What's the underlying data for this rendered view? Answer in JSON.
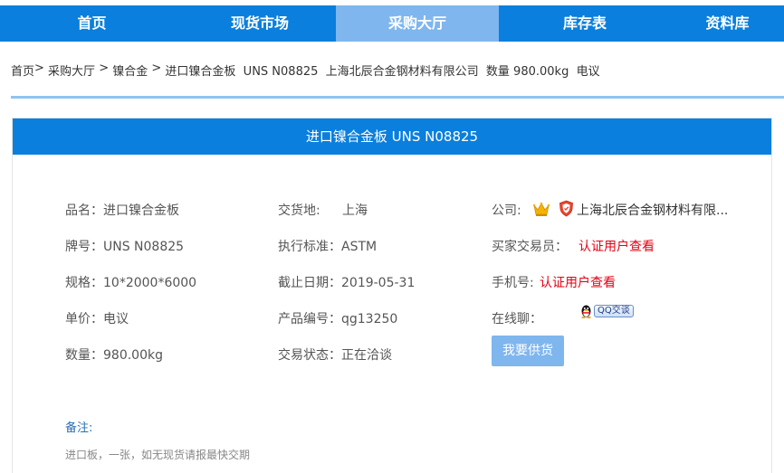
{
  "nav": {
    "items": [
      {
        "label": "首页"
      },
      {
        "label": "现货市场"
      },
      {
        "label": "采购大厅"
      },
      {
        "label": "库存表"
      },
      {
        "label": "资料库"
      }
    ],
    "active_index": 2
  },
  "breadcrumb": {
    "home": "首页",
    "sep1": "> ",
    "purchase": "采购大厅",
    "sep2": " > ",
    "category": "镍合金",
    "sep3": " > ",
    "current": "进口镍合金板  UNS N08825  上海北辰合金钢材料有限公司  数量 980.00kg  电议"
  },
  "panel": {
    "title": "进口镍合金板 UNS N08825"
  },
  "details": {
    "name": "品名：进口镍合金板",
    "grade": "牌号：UNS N08825",
    "spec": "规格：10*2000*6000",
    "price": "单价：电议",
    "quantity": "数量：980.00kg",
    "delivery_label": "交货地:",
    "delivery_value": "上海",
    "standard": "执行标准：ASTM",
    "deadline": "截止日期：2019-05-31",
    "product_no": "产品编号：qg13250",
    "trade_status": "交易状态：正在洽谈",
    "company_label": "公司:",
    "company_value": "上海北辰合金钢材料有限...",
    "buyer_label": "买家交易员：",
    "buyer_value": "认证用户查看",
    "phone_label": "手机号:",
    "phone_value": "认证用户查看",
    "chat_label": "在线聊：",
    "qq_badge": "QQ交谈"
  },
  "supply_button": "我要供货",
  "remark": {
    "label": "备注:",
    "text": "进口板，一张，如无现货请报最快交期"
  },
  "colors": {
    "nav_bg": "#0a7fdd",
    "nav_active": "#7fb6ee",
    "divider": "#8ec4f0",
    "link_red": "#e60012",
    "remark_label": "#2a6fb5"
  },
  "icons": {
    "crown": "crown-icon",
    "shield": "shield-icon",
    "qq": "qq-penguin-icon"
  }
}
